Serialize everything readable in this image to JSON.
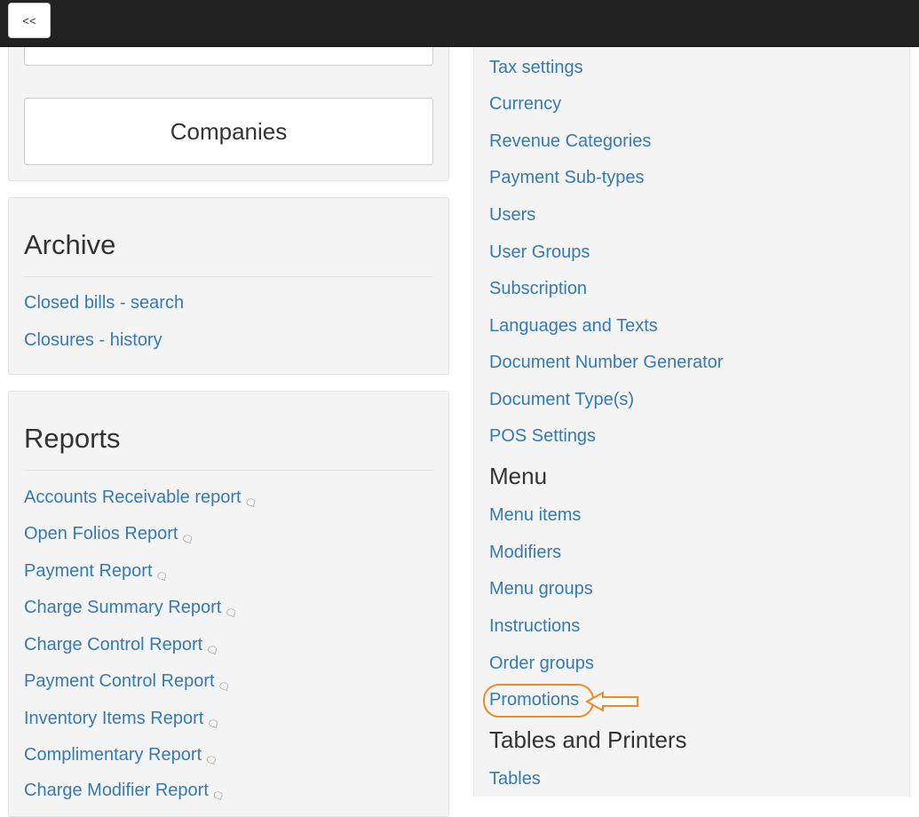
{
  "toolbar": {
    "back_label": "<<"
  },
  "left": {
    "companies_label": "Companies",
    "archive": {
      "title": "Archive",
      "items": [
        {
          "label": "Closed bills - search"
        },
        {
          "label": "Closures - history"
        }
      ]
    },
    "reports": {
      "title": "Reports",
      "comment_icon": "speech-bubble-icon",
      "items": [
        {
          "label": "Accounts Receivable report"
        },
        {
          "label": "Open Folios Report"
        },
        {
          "label": "Payment Report"
        },
        {
          "label": "Charge Summary Report"
        },
        {
          "label": "Charge Control Report"
        },
        {
          "label": "Payment Control Report"
        },
        {
          "label": "Inventory Items Report"
        },
        {
          "label": "Complimentary Report"
        },
        {
          "label": "Charge Modifier Report"
        }
      ]
    }
  },
  "right": {
    "settings_links": [
      {
        "label": "Tax settings"
      },
      {
        "label": "Currency"
      },
      {
        "label": "Revenue Categories"
      },
      {
        "label": "Payment Sub-types"
      },
      {
        "label": "Users"
      },
      {
        "label": "User Groups"
      },
      {
        "label": "Subscription"
      },
      {
        "label": "Languages and Texts"
      },
      {
        "label": "Document Number Generator"
      },
      {
        "label": "Document Type(s)"
      },
      {
        "label": "POS Settings"
      }
    ],
    "menu": {
      "title": "Menu",
      "links": [
        {
          "label": "Menu items"
        },
        {
          "label": "Modifiers"
        },
        {
          "label": "Menu groups"
        },
        {
          "label": "Instructions"
        },
        {
          "label": "Order groups"
        },
        {
          "label": "Promotions"
        }
      ]
    },
    "tables": {
      "title": "Tables and Printers",
      "links": [
        {
          "label": "Tables"
        }
      ]
    }
  },
  "colors": {
    "link": "#337ab7",
    "topbar": "#222222",
    "panel_bg": "#f4f4f4",
    "annotation": "#f08a24"
  }
}
